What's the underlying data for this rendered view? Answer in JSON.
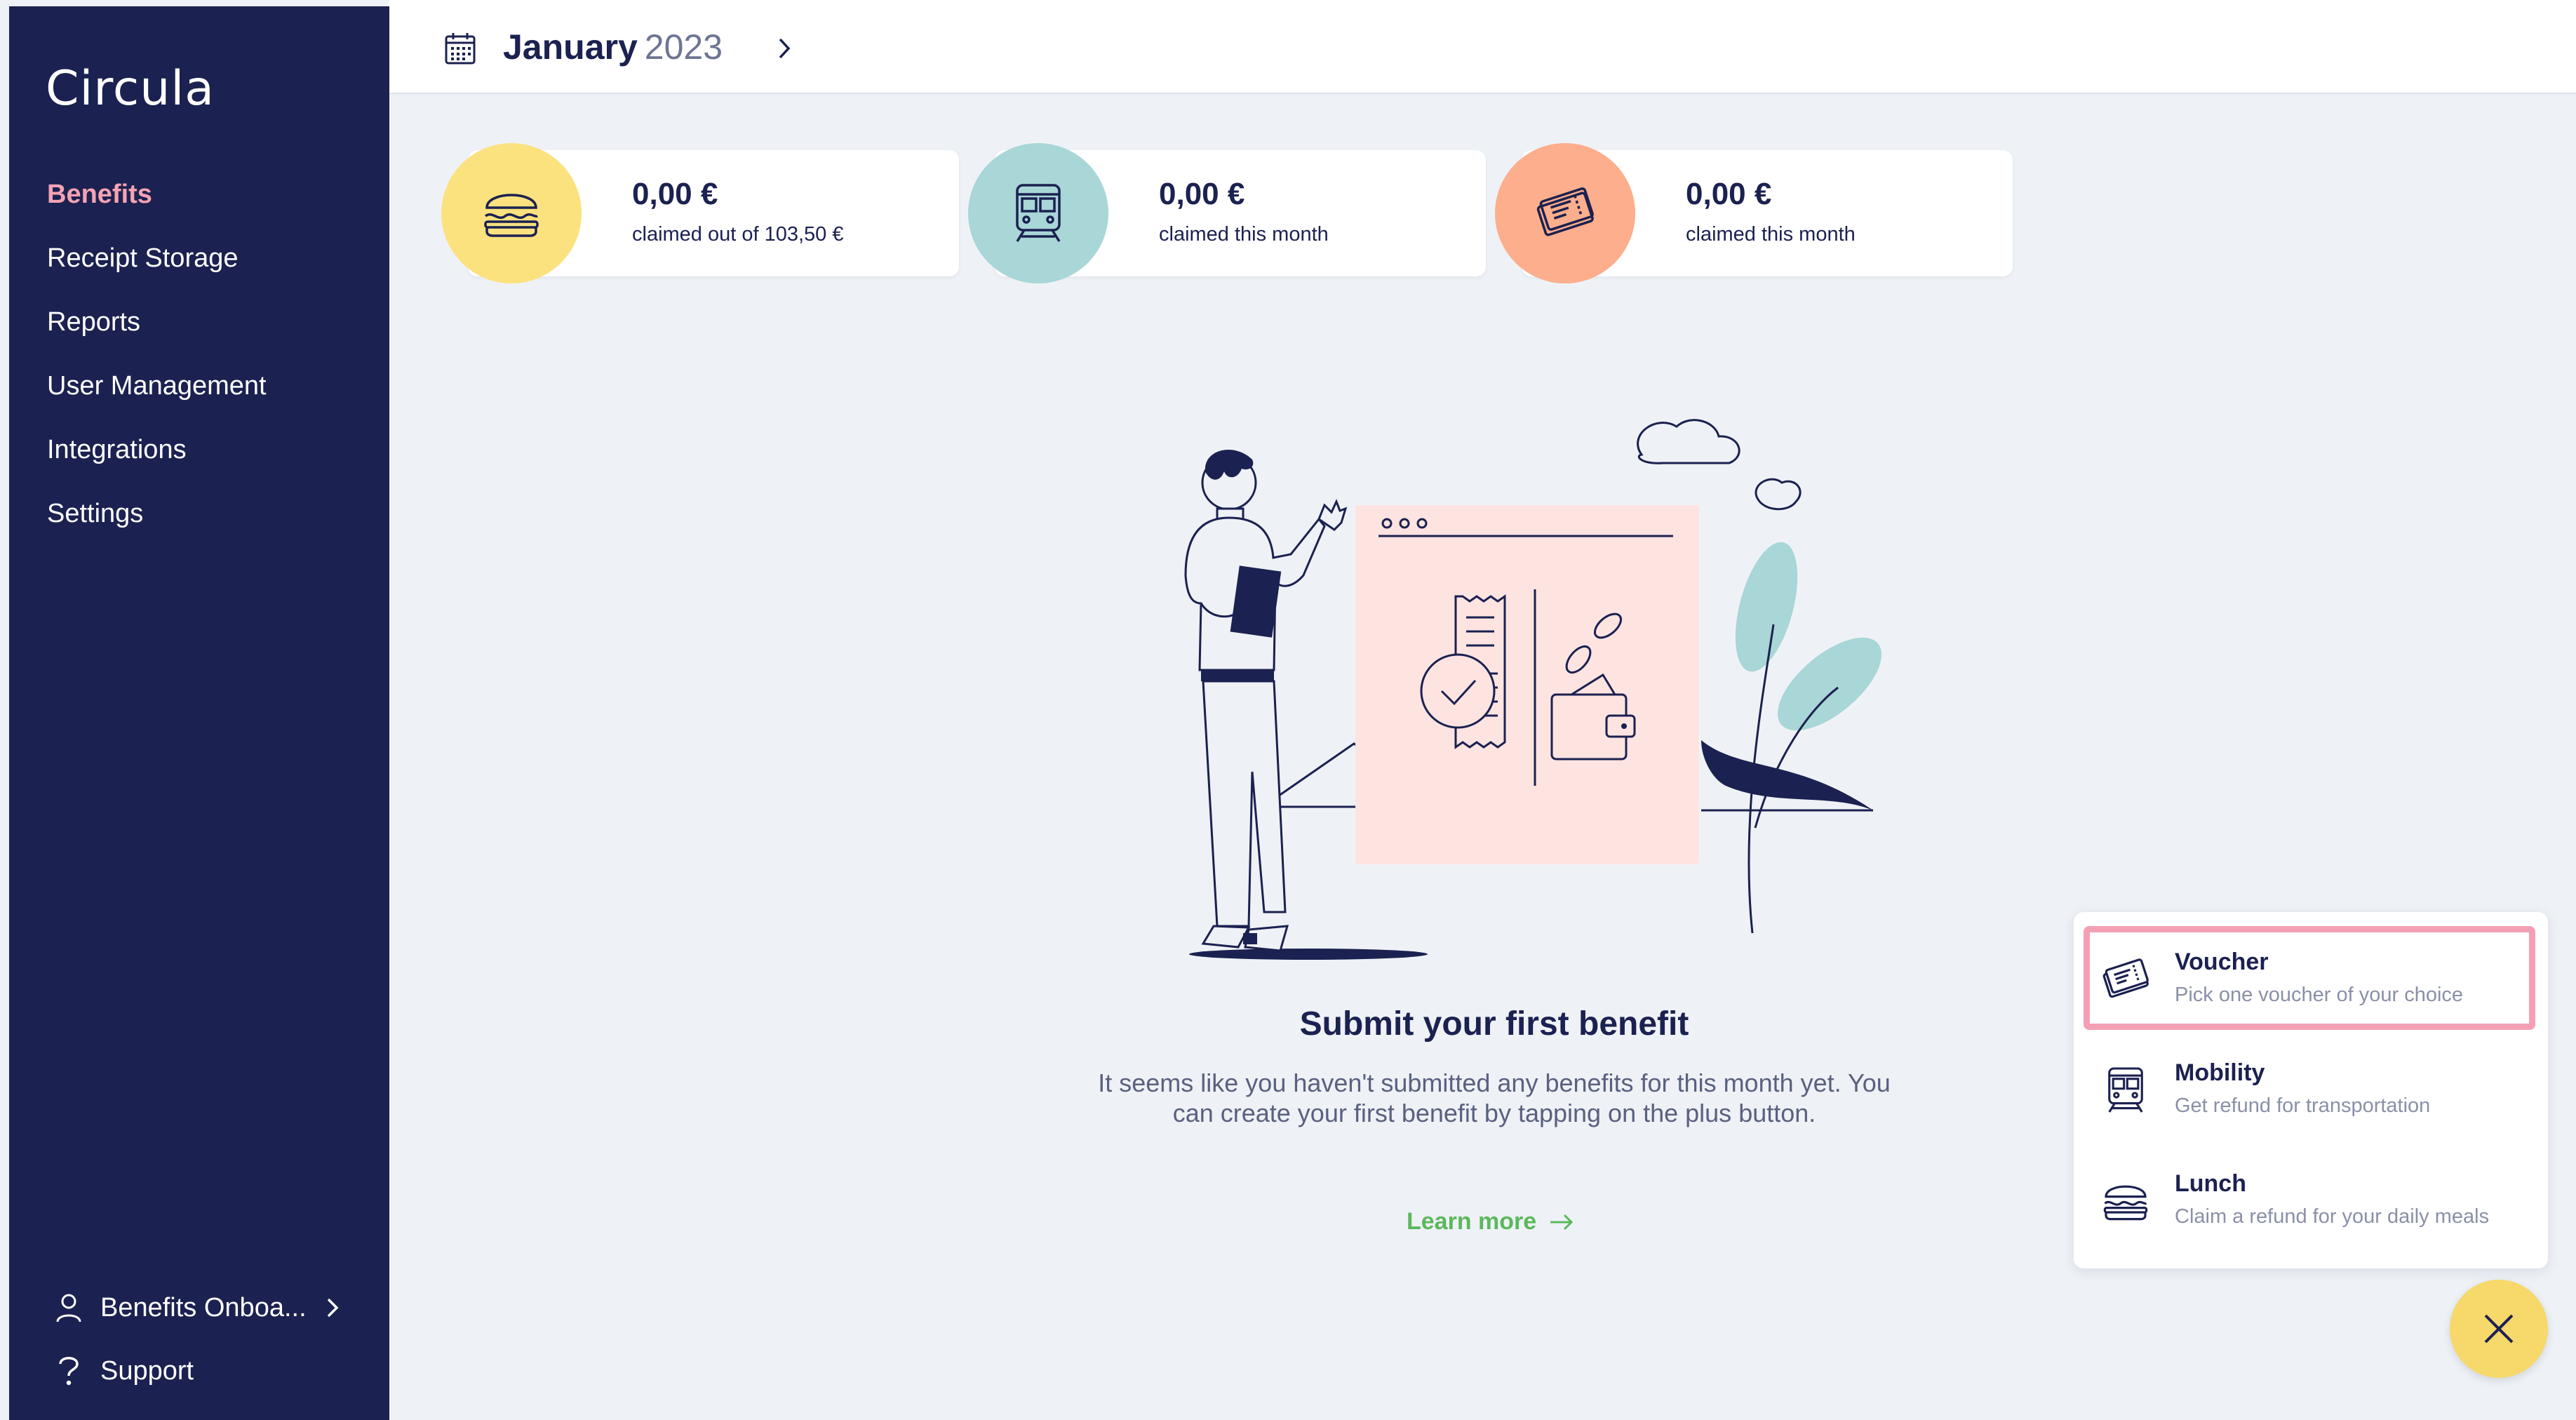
{
  "app": {
    "logo": "Circula"
  },
  "sidebar": {
    "items": [
      {
        "label": "Benefits",
        "active": true
      },
      {
        "label": "Receipt Storage"
      },
      {
        "label": "Reports"
      },
      {
        "label": "User Management"
      },
      {
        "label": "Integrations"
      },
      {
        "label": "Settings"
      }
    ],
    "account_label": "Benefits Onboa...",
    "support_label": "Support",
    "icons": {
      "account": "user-icon",
      "support": "question-icon",
      "account_chevron": "chevron-right-icon"
    }
  },
  "header": {
    "month": "January",
    "year": "2023",
    "icons": {
      "calendar": "calendar-icon",
      "next": "chevron-right-icon"
    }
  },
  "cards": [
    {
      "amount": "0,00 €",
      "subtitle": "claimed out of 103,50 €",
      "icon": "burger-icon",
      "color": "#fbe27f"
    },
    {
      "amount": "0,00 €",
      "subtitle": "claimed this month",
      "icon": "train-icon",
      "color": "#a9d6d6"
    },
    {
      "amount": "0,00 €",
      "subtitle": "claimed this month",
      "icon": "ticket-icon",
      "color": "#fdae8c"
    }
  ],
  "empty_state": {
    "title": "Submit your first benefit",
    "text": "It seems like you haven't submitted any benefits for this month yet. You can create your first benefit by tapping on the plus button.",
    "link": "Learn more"
  },
  "menu": {
    "items": [
      {
        "title": "Voucher",
        "subtitle": "Pick one voucher of your choice",
        "icon": "ticket-icon",
        "selected": true
      },
      {
        "title": "Mobility",
        "subtitle": "Get refund for transportation",
        "icon": "train-icon"
      },
      {
        "title": "Lunch",
        "subtitle": "Claim a refund for your daily meals",
        "icon": "burger-icon"
      }
    ]
  },
  "fab": {
    "icon": "close-icon",
    "color": "#f6d86b"
  },
  "colors": {
    "sidebar": "#1b2150",
    "active_nav": "#f4a3b3",
    "background": "#eef2f6",
    "link": "#5cb85c",
    "selected_outline": "#f3a0b5"
  }
}
